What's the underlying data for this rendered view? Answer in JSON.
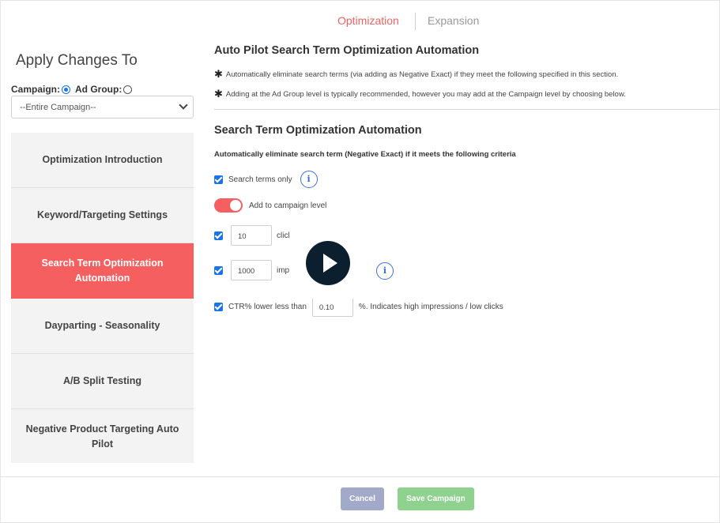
{
  "tabs": {
    "optimization": "Optimization",
    "expansion": "Expansion",
    "active": "Optimization"
  },
  "left": {
    "title": "Apply Changes To",
    "campaign_label": "Campaign:",
    "adgroup_label": "Ad Group:",
    "selected_scope": "Campaign",
    "select_value": "--Entire Campaign--",
    "menu": [
      {
        "label": "Optimization Introduction",
        "active": false
      },
      {
        "label": "Keyword/Targeting Settings",
        "active": false
      },
      {
        "label": "Search Term Optimization Automation",
        "active": true
      },
      {
        "label": "Dayparting - Seasonality",
        "active": false
      },
      {
        "label": "A/B Split Testing",
        "active": false
      },
      {
        "label": "Negative Product Targeting Auto Pilot",
        "active": false
      }
    ]
  },
  "main": {
    "heading": "Auto Pilot Search Term Optimization Automation",
    "note1": "Automatically eliminate search terms (via adding as Negative Exact) if they meet the following specified in this section.",
    "note2": "Adding at the Ad Group level is typically recommended, however you may add at the Campaign level by choosing below.",
    "subheading": "Search Term Optimization Automation",
    "criteria_intro": "Automatically eliminate search term (Negative Exact) if it meets the following criteria",
    "search_terms_only": {
      "label": "Search terms only",
      "checked": true
    },
    "add_to_campaign": {
      "label": "Add to campaign level",
      "on": true
    },
    "clicks": {
      "value": "10",
      "label": "click(",
      "checked": true
    },
    "impressions": {
      "value": "1000",
      "label": "impr",
      "checked": true
    },
    "ctr": {
      "prefix": "CTR% lower less than",
      "value": "0.10",
      "suffix": "%. Indicates high impressions / low clicks",
      "checked": true
    },
    "info_glyph": "i"
  },
  "footer": {
    "cancel": "Cancel",
    "save": "Save Campaign"
  },
  "colors": {
    "accent": "#f55f5f",
    "link_blue": "#1a73e8",
    "cancel_bg": "#a3a9c8",
    "save_bg": "#8fd18f"
  },
  "icons": [
    "chevron-down-icon",
    "info-icon",
    "play-icon",
    "asterisk-icon",
    "checkbox-icon"
  ]
}
